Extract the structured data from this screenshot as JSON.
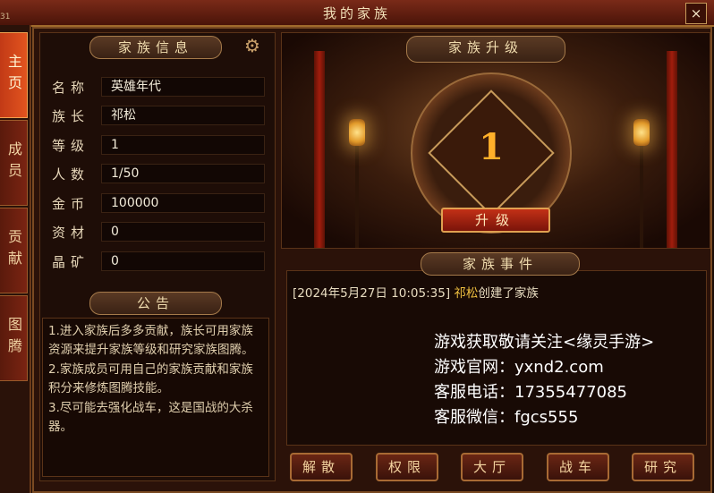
{
  "window": {
    "title": "我的家族",
    "close_label": "×",
    "corner_label": "31"
  },
  "sidebar": {
    "tabs": [
      {
        "label": "主页",
        "active": true
      },
      {
        "label": "成员",
        "active": false
      },
      {
        "label": "贡献",
        "active": false
      },
      {
        "label": "图腾",
        "active": false
      }
    ]
  },
  "family_info": {
    "heading": "家族信息",
    "rows": [
      {
        "label": "名称",
        "value": "英雄年代"
      },
      {
        "label": "族长",
        "value": "祁松"
      },
      {
        "label": "等级",
        "value": "1"
      },
      {
        "label": "人数",
        "value": "1/50"
      },
      {
        "label": "金币",
        "value": "100000"
      },
      {
        "label": "资材",
        "value": "0"
      },
      {
        "label": "晶矿",
        "value": "0"
      }
    ]
  },
  "notice": {
    "heading": "公告",
    "lines": [
      "1.进入家族后多多贡献，族长可用家族资源来提升家族等级和研究家族图腾。",
      "2.家族成员可用自己的家族贡献和家族积分来修炼图腾技能。",
      "3.尽可能去强化战车，这是国战的大杀器。"
    ]
  },
  "upgrade": {
    "heading": "家族升级",
    "level": "1",
    "button_label": "升级"
  },
  "events": {
    "heading": "家族事件",
    "items": [
      {
        "time": "[2024年5月27日 10:05:35]",
        "actor": "祁松",
        "text": "创建了家族"
      }
    ]
  },
  "watermark": {
    "lines": [
      "游戏获取敬请关注<缘灵手游>",
      "游戏官网：yxnd2.com",
      "客服电话：17355477085",
      "客服微信：fgcs555"
    ]
  },
  "bottom_buttons": [
    "解散",
    "权限",
    "大厅",
    "战车",
    "研究"
  ],
  "colors": {
    "accent": "#e2541f",
    "gold": "#ffb02a",
    "event_name": "#f0c040"
  }
}
